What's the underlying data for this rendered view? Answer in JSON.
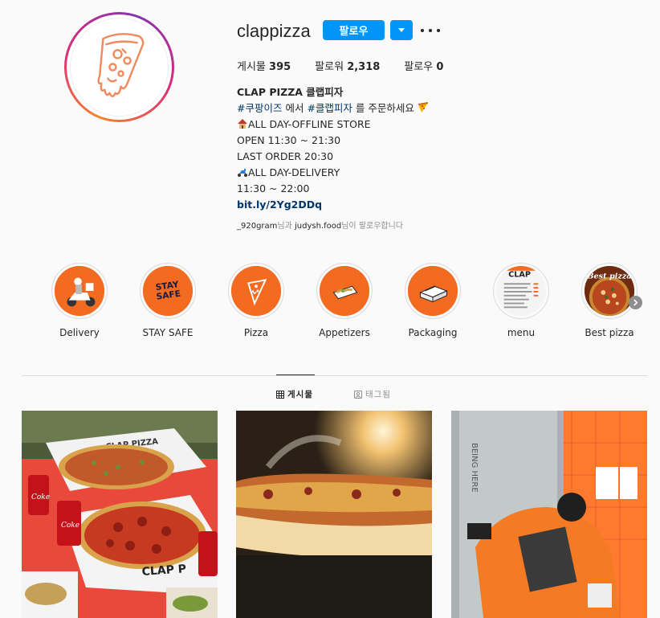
{
  "profile": {
    "username": "clappizza",
    "follow_label": "팔로우",
    "stats": {
      "posts_label": "게시물",
      "posts_value": "395",
      "followers_label": "팔로워",
      "followers_value": "2,318",
      "following_label": "팔로우",
      "following_value": "0"
    },
    "bio": {
      "name": "CLAP PIZZA 클랩피자",
      "line2_tag1": "#쿠팡이즈",
      "line2_mid": " 에서 ",
      "line2_tag2": "#클랩피자",
      "line2_end": " 를 주문하세요",
      "line3": "ALL DAY-OFFLINE STORE",
      "line4": "OPEN 11:30 ~ 21:30",
      "line5": "LAST ORDER 20:30",
      "line6": "ALL DAY-DELIVERY",
      "line7": "11:30 ~ 22:00",
      "link": "bit.ly/2Yg2DDq"
    },
    "followed_by": {
      "user1": "_920gram",
      "mid": "님과 ",
      "user2": "judysh.food",
      "end": "님이 팔로우합니다"
    }
  },
  "highlights": [
    {
      "label": "Delivery",
      "icon": "scooter-icon"
    },
    {
      "label": "STAY SAFE",
      "icon": "stay-safe-icon"
    },
    {
      "label": "Pizza",
      "icon": "pizza-slice-icon"
    },
    {
      "label": "Appetizers",
      "icon": "appetizer-icon"
    },
    {
      "label": "Packaging",
      "icon": "box-icon"
    },
    {
      "label": "menu",
      "icon": "menu-board-icon"
    },
    {
      "label": "Best pizza",
      "icon": "pizza-photo-icon"
    }
  ],
  "highlight_overlay": {
    "stay_safe_text": "STAY SAFE",
    "menu_text": "CLAP",
    "best_text": "Best pizza"
  },
  "tabs": {
    "posts": "게시물",
    "tagged": "태그됨"
  },
  "posts_overlay": {
    "box_text_1": "CLAP PIZZA",
    "box_text_2": "CLAP P",
    "can_text": "Coke",
    "wall_text": "BEING HERE"
  },
  "colors": {
    "accent": "#0095f6",
    "brand_orange": "#f26b21",
    "link": "#00376b"
  }
}
